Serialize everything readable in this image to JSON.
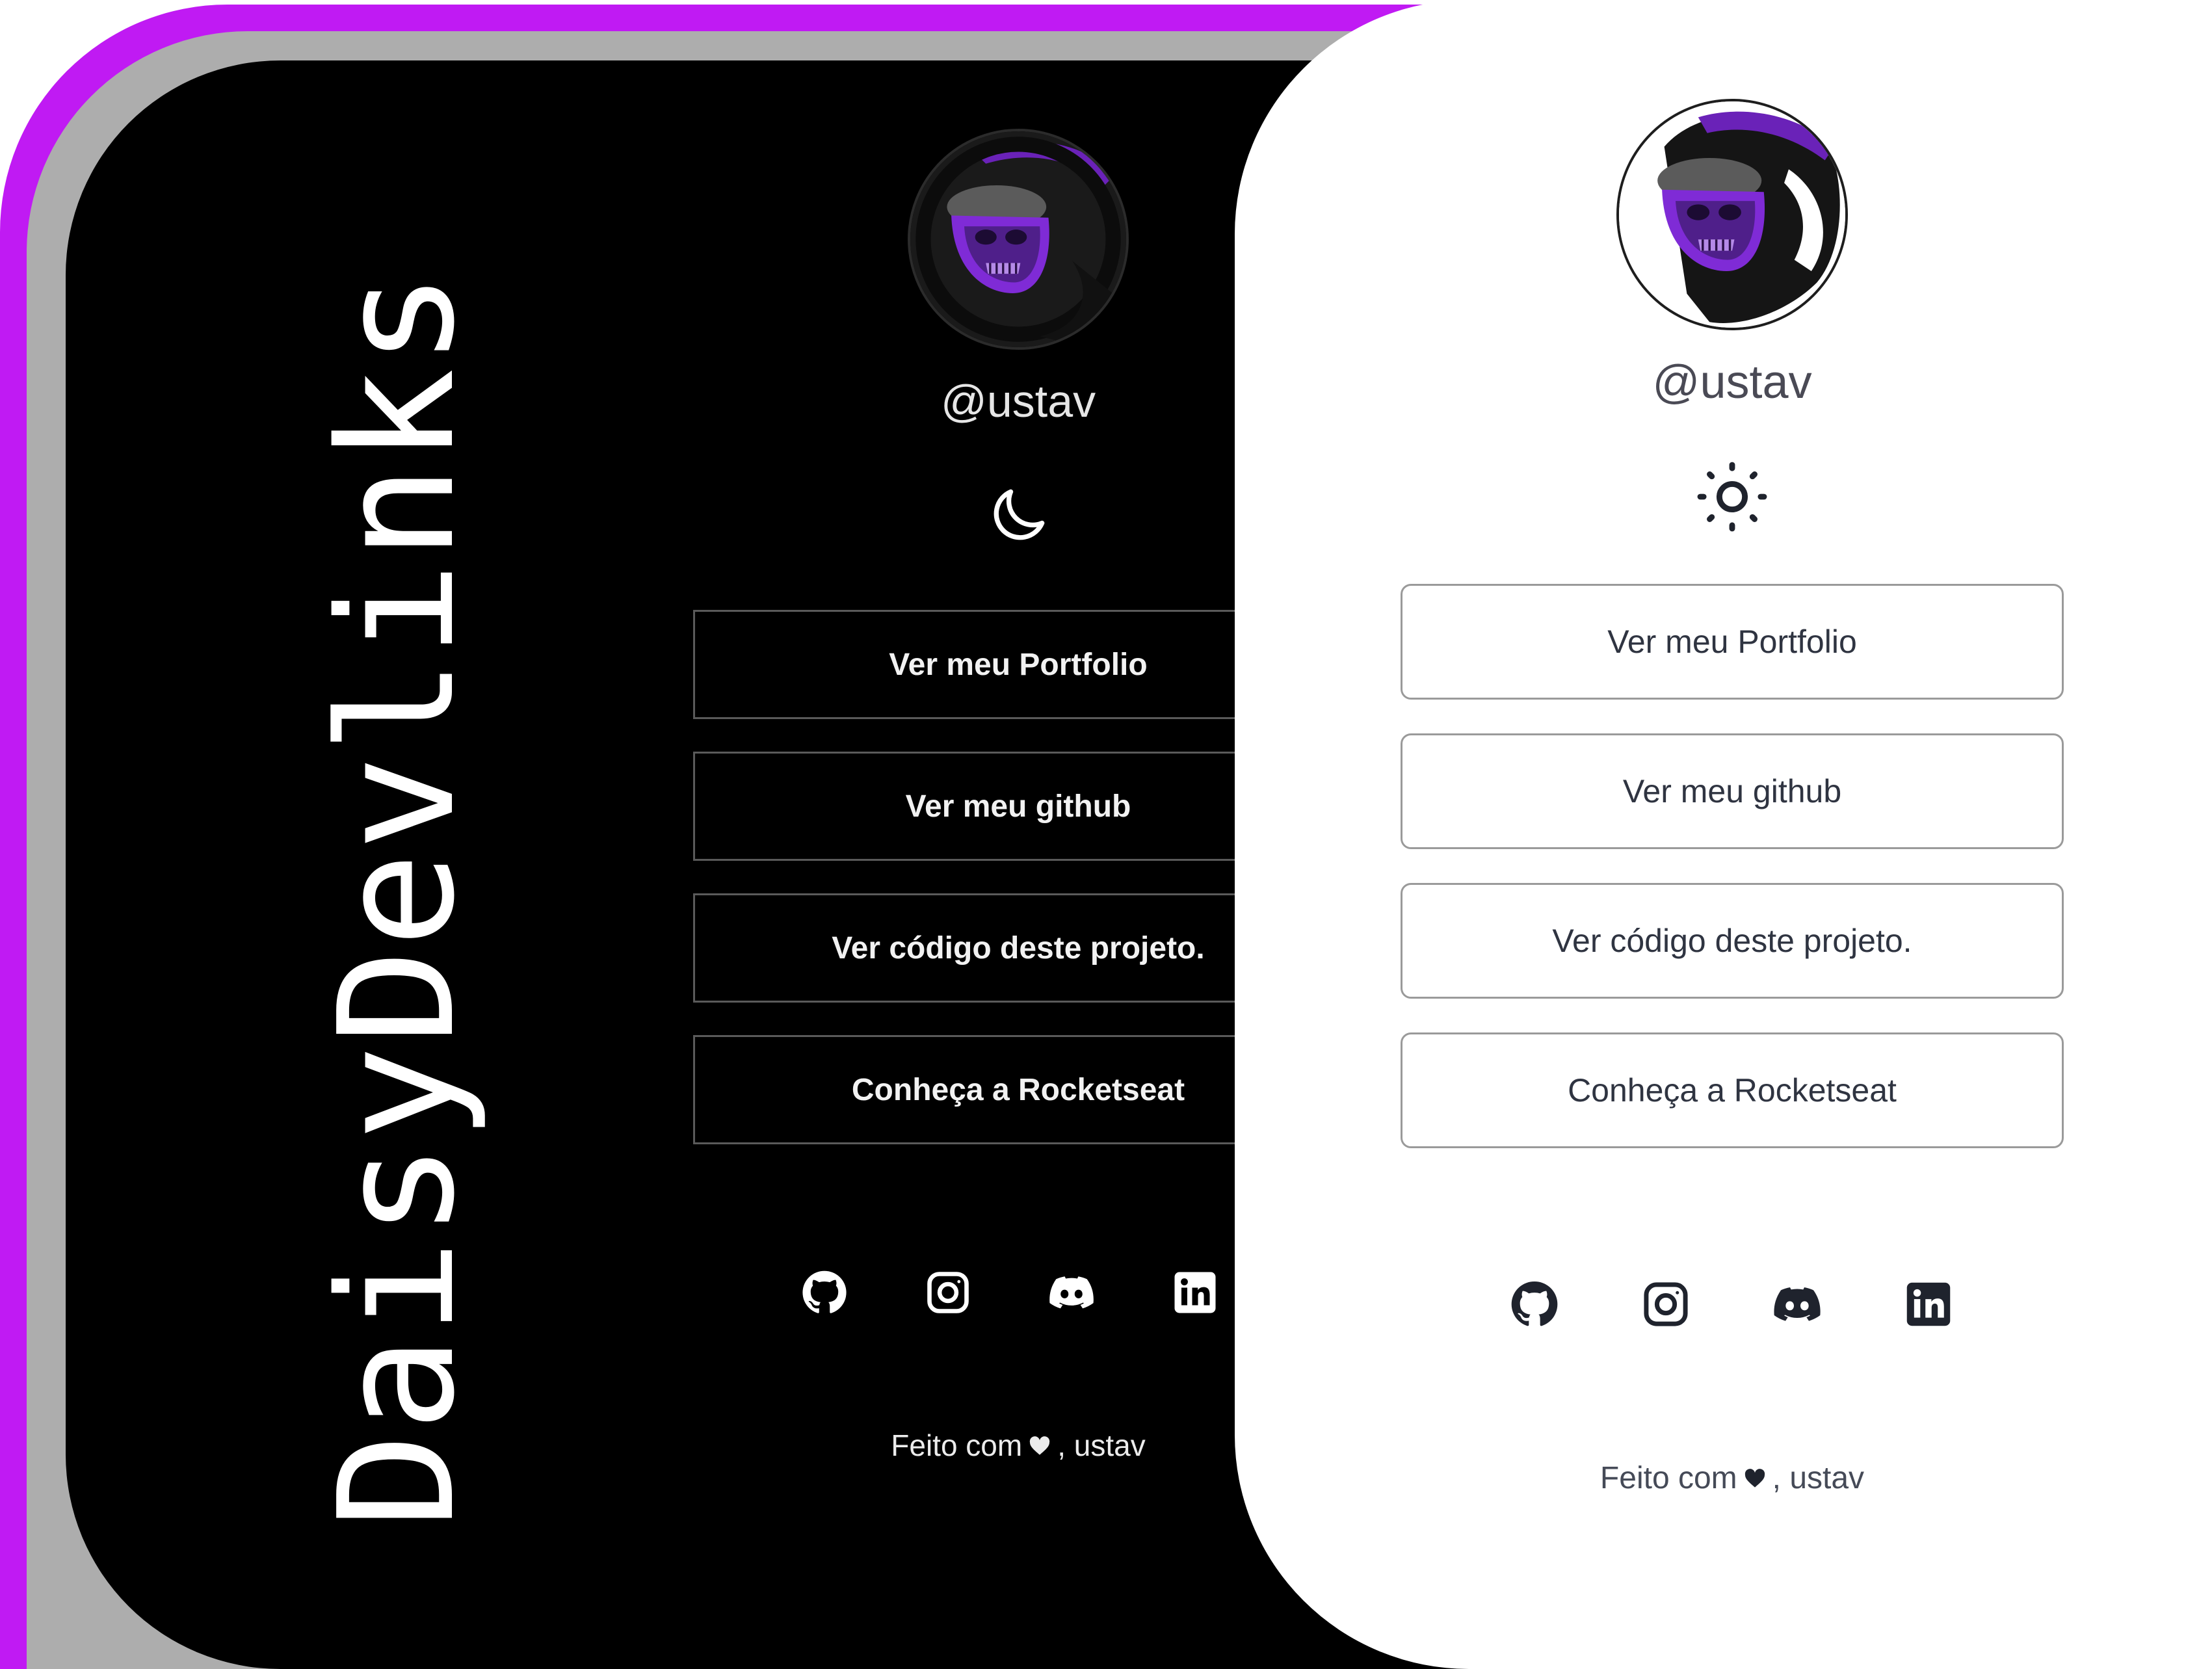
{
  "app_title": "DaisyDevlinks",
  "dark_theme": {
    "username": "@ustav",
    "theme_toggle_icon": "moon-icon",
    "buttons": [
      {
        "label": "Ver meu Portfolio"
      },
      {
        "label": "Ver meu github"
      },
      {
        "label": "Ver código deste projeto."
      },
      {
        "label": "Conheça a Rocketseat"
      }
    ],
    "socials": [
      "github-icon",
      "instagram-icon",
      "discord-icon",
      "linkedin-icon"
    ],
    "footer": {
      "prefix": "Feito com",
      "suffix": ", ustav"
    }
  },
  "light_theme": {
    "username": "@ustav",
    "theme_toggle_icon": "sun-icon",
    "buttons": [
      {
        "label": "Ver meu Portfolio"
      },
      {
        "label": "Ver meu github"
      },
      {
        "label": "Ver código deste projeto."
      },
      {
        "label": "Conheça a Rocketseat"
      }
    ],
    "socials": [
      "github-icon",
      "instagram-icon",
      "discord-icon",
      "linkedin-icon"
    ],
    "footer": {
      "prefix": "Feito com",
      "suffix": ", ustav"
    }
  },
  "colors": {
    "accent_purple": "#c01af3",
    "layer_gray": "#adadad",
    "dark_bg": "#000000",
    "light_bg": "#ffffff"
  }
}
